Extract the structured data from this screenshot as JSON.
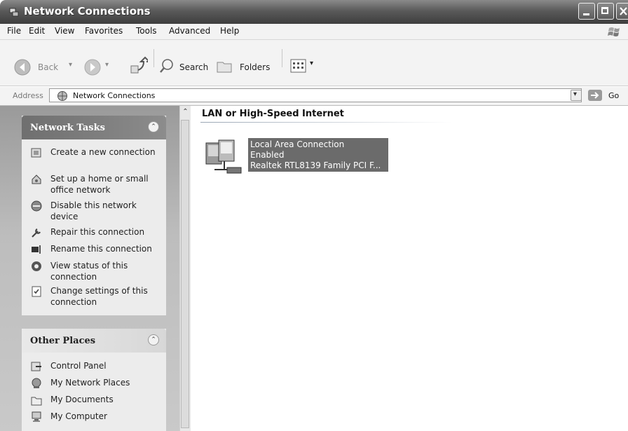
{
  "window": {
    "title": "Network Connections"
  },
  "menu": [
    "File",
    "Edit",
    "View",
    "Favorites",
    "Tools",
    "Advanced",
    "Help"
  ],
  "toolbar": {
    "back_label": "Back",
    "search_label": "Search",
    "folders_label": "Folders"
  },
  "address": {
    "label": "Address",
    "value": "Network Connections",
    "go_label": "Go"
  },
  "network_tasks": {
    "title": "Network Tasks",
    "items": [
      {
        "label": "Create a new connection",
        "icon": "new-connection-icon"
      },
      {
        "label": "Set up a home or small office network",
        "icon": "home-network-icon"
      },
      {
        "label": "Disable this network device",
        "icon": "disable-network-icon"
      },
      {
        "label": "Repair this connection",
        "icon": "repair-icon"
      },
      {
        "label": "Rename this connection",
        "icon": "rename-icon"
      },
      {
        "label": "View status of this connection",
        "icon": "status-icon"
      },
      {
        "label": "Change settings of this connection",
        "icon": "settings-icon"
      }
    ]
  },
  "other_places": {
    "title": "Other Places",
    "items": [
      {
        "label": "Control Panel",
        "icon": "control-panel-icon"
      },
      {
        "label": "My Network Places",
        "icon": "network-places-icon"
      },
      {
        "label": "My Documents",
        "icon": "documents-icon"
      },
      {
        "label": "My Computer",
        "icon": "computer-icon"
      }
    ]
  },
  "content": {
    "group_header": "LAN or High-Speed Internet",
    "connection": {
      "name": "Local Area Connection",
      "status": "Enabled",
      "device": "Realtek RTL8139 Family PCI F..."
    }
  },
  "colors": {
    "selection": "#6b6b6b",
    "pane_header": "#7a7a7a",
    "title_bar": "#5a5a5a"
  }
}
